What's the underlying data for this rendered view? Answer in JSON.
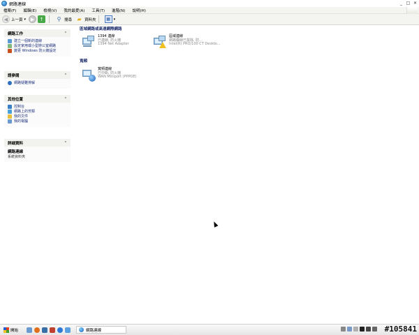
{
  "window": {
    "title": "網路連線"
  },
  "menu": {
    "items": [
      "檔案(F)",
      "編輯(E)",
      "檢視(V)",
      "我的最愛(A)",
      "工具(T)",
      "進階(N)",
      "說明(H)"
    ]
  },
  "toolbar": {
    "back_label": "上一頁",
    "search_label": "搜尋",
    "folder_label": "資料夾"
  },
  "left_panel": {
    "network_tasks": {
      "title": "網路工作",
      "items": [
        "建立一個新的連線",
        "設定家用或小型辦公室網路",
        "變更 Windows 防火牆設定"
      ]
    },
    "see_also": {
      "title": "請參閱",
      "items": [
        "網路疑難排解"
      ]
    },
    "other_places": {
      "title": "其他位置",
      "items": [
        "控制台",
        "網路上的芳鄰",
        "我的文件",
        "我的電腦"
      ]
    },
    "details": {
      "title": "詳細資料",
      "name": "網路連線",
      "subtitle": "系統資料夾"
    }
  },
  "main": {
    "lan_section_title": "區域網路或高速網際網路",
    "broadband_section_title": "寬頻",
    "connections": [
      {
        "name": "1394 連線",
        "status": "已連線, 防火牆",
        "device": "1394 Net Adapter"
      },
      {
        "name": "區域連線",
        "status": "網路纜線已拔除, 防...",
        "device": "Intel(R) PRO/100 CT Deskto..."
      },
      {
        "name": "寬頻連線",
        "status": "已中斷, 防火牆",
        "device": "WAN Miniport (PPPOE)"
      }
    ]
  },
  "taskbar": {
    "start_label": "開始",
    "open_window_label": "網路連線",
    "watermark": "#105841"
  }
}
